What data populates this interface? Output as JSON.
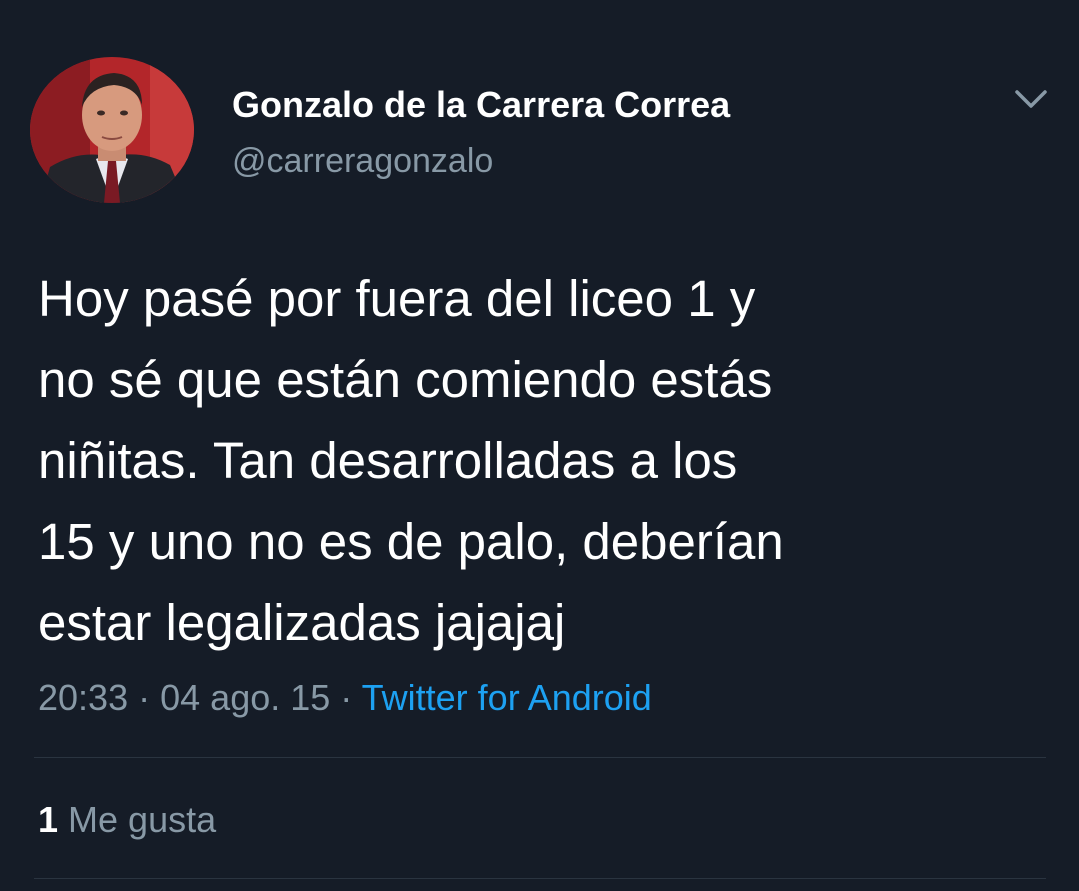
{
  "author": {
    "display_name": "Gonzalo de la Carrera Correa",
    "handle": "@carreragonzalo"
  },
  "tweet": {
    "text": "Hoy pasé por fuera del liceo 1 y\nno sé que están comiendo estás\nniñitas. Tan desarrolladas a los\n15 y uno no es de palo, deberían\nestar legalizadas jajajaj",
    "time": "20:33",
    "date": "04 ago. 15",
    "separator": "·",
    "source": "Twitter for Android"
  },
  "engagement": {
    "likes_count": "1",
    "likes_label": "Me gusta"
  },
  "icons": {
    "menu": "chevron-down-icon"
  },
  "colors": {
    "background": "#151c27",
    "text": "#ffffff",
    "secondary": "#8899a6",
    "link": "#1da1f2"
  }
}
